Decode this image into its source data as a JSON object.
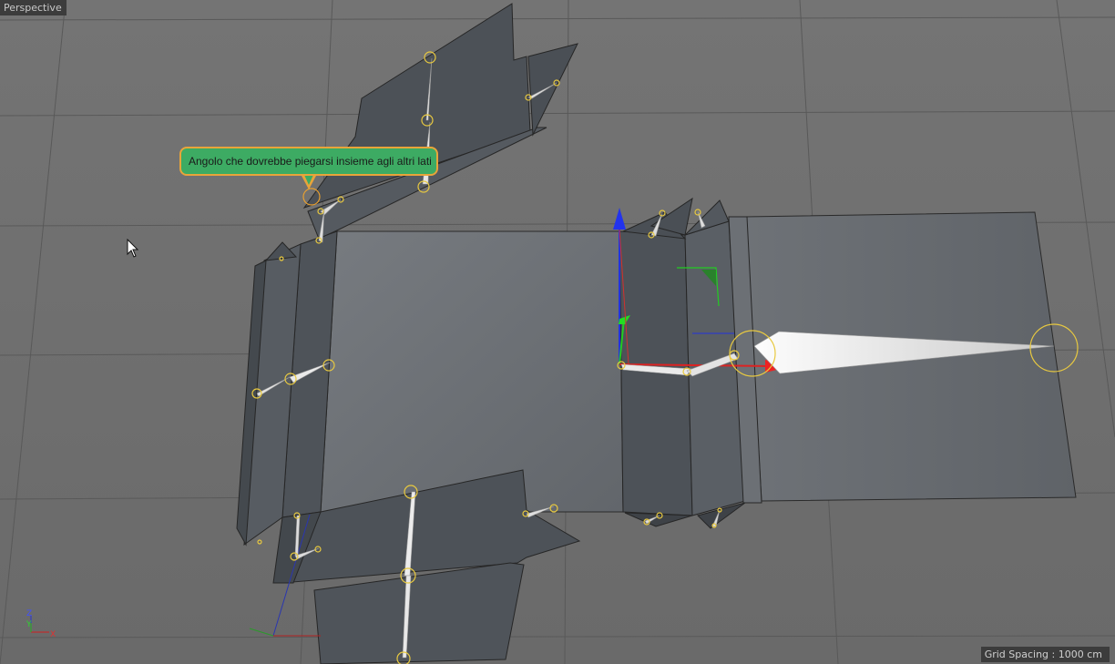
{
  "viewport": {
    "label": "Perspective",
    "grid_spacing": "Grid Spacing : 1000 cm"
  },
  "callout": {
    "text": "Angolo che dovrebbe piegarsi insieme agli altri lati"
  },
  "axis_indicator": {
    "x": "X",
    "y": "Y",
    "z": "Z"
  },
  "colors": {
    "background": "#6e6e6e",
    "mesh_face": "#4e535a",
    "mesh_face_light": "#686d73",
    "callout_fill": "#3dab63",
    "callout_border": "#e9a43a",
    "joint_highlight": "#f0d24a",
    "axis_x": "#e02020",
    "axis_y": "#20d020",
    "axis_z": "#2030e0"
  }
}
